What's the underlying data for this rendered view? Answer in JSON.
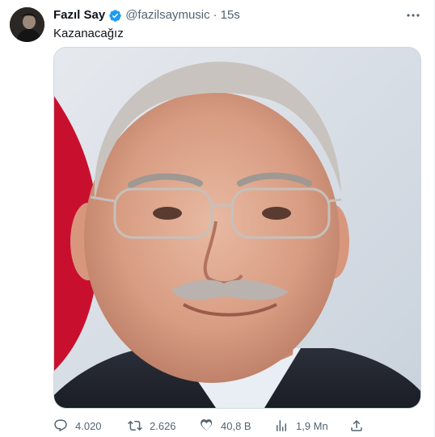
{
  "tweet": {
    "author_name": "Fazıl Say",
    "handle": "@fazilsaymusic",
    "separator": "·",
    "time": "15s",
    "text": "Kazanacağız"
  },
  "actions": {
    "replies": "4.020",
    "retweets": "2.626",
    "likes": "40,8 B",
    "views": "1,9 Mn"
  },
  "icons": {
    "verified": "verified-badge-icon",
    "more": "more-icon",
    "reply": "reply-icon",
    "retweet": "retweet-icon",
    "like": "heart-icon",
    "views": "views-chart-icon",
    "share": "share-icon"
  },
  "colors": {
    "verified": "#1d9bf0",
    "secondary_text": "#536471",
    "primary_text": "#0f1419"
  }
}
